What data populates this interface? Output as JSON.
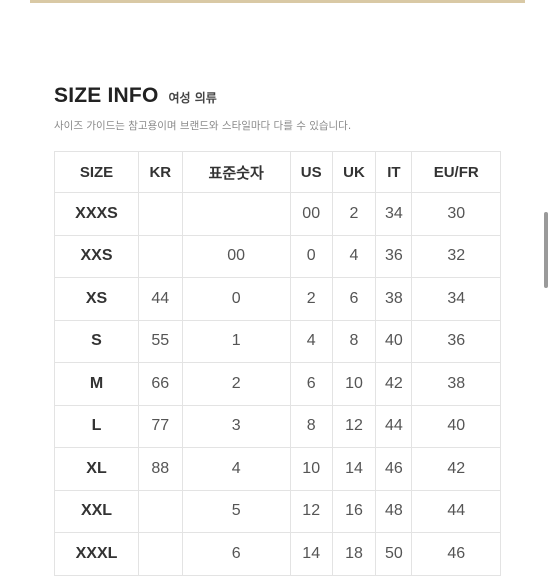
{
  "header": {
    "title": "SIZE INFO",
    "subtitle": "여성 의류",
    "note": "사이즈 가이드는 참고용이며 브랜드와 스타일마다 다를 수 있습니다."
  },
  "table": {
    "columns": [
      "SIZE",
      "KR",
      "표준숫자",
      "US",
      "UK",
      "IT",
      "EU/FR"
    ],
    "rows": [
      [
        "XXXS",
        "",
        "",
        "00",
        "2",
        "34",
        "30"
      ],
      [
        "XXS",
        "",
        "00",
        "0",
        "4",
        "36",
        "32"
      ],
      [
        "XS",
        "44",
        "0",
        "2",
        "6",
        "38",
        "34"
      ],
      [
        "S",
        "55",
        "1",
        "4",
        "8",
        "40",
        "36"
      ],
      [
        "M",
        "66",
        "2",
        "6",
        "10",
        "42",
        "38"
      ],
      [
        "L",
        "77",
        "3",
        "8",
        "12",
        "44",
        "40"
      ],
      [
        "XL",
        "88",
        "4",
        "10",
        "14",
        "46",
        "42"
      ],
      [
        "XXL",
        "",
        "5",
        "12",
        "16",
        "48",
        "44"
      ],
      [
        "XXXL",
        "",
        "6",
        "14",
        "18",
        "50",
        "46"
      ]
    ]
  }
}
